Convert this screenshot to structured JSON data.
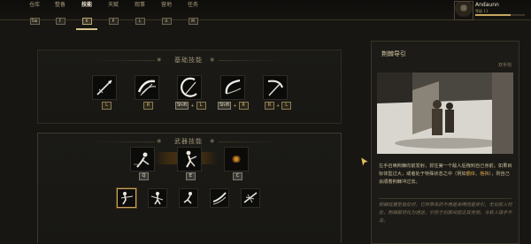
{
  "nav": {
    "tabs": [
      {
        "label": "仓库",
        "key": "Tab"
      },
      {
        "label": "整备",
        "key": "F"
      },
      {
        "label": "技能",
        "key": "K"
      },
      {
        "label": "天赋",
        "key": "P"
      },
      {
        "label": "观事",
        "key": "L"
      },
      {
        "label": "营地",
        "key": "U"
      },
      {
        "label": "任务",
        "key": "M"
      }
    ],
    "active_index": 2
  },
  "player": {
    "name": "Andaunn",
    "subtitle": "等级 11",
    "progress": 0.71
  },
  "basic": {
    "title": "基础技能",
    "skills": [
      {
        "icon": "spear-icon",
        "keys": [
          "L"
        ]
      },
      {
        "icon": "slash-icon",
        "keys": [
          "R"
        ]
      },
      {
        "icon": "crescent-slash-icon",
        "keys": [
          "Shift",
          "L"
        ]
      },
      {
        "icon": "sweep-slash-icon",
        "keys": [
          "Shift",
          "R"
        ]
      },
      {
        "icon": "scythe-icon",
        "keys": [
          "R",
          "L"
        ]
      }
    ]
  },
  "weapon": {
    "title": "武器技能",
    "skills": [
      {
        "icon": "dash-strike-icon",
        "key": "Q"
      },
      {
        "icon": "ninja-leap-icon",
        "key": "E"
      },
      {
        "icon": "locked-skill-icon",
        "key": "C"
      }
    ],
    "row2": [
      {
        "icon": "piercing-stance-icon",
        "selected": true
      },
      {
        "icon": "warrior-stance-icon"
      },
      {
        "icon": "leaping-stance-icon"
      },
      {
        "icon": "wind-slash-icon"
      },
      {
        "icon": "thrust-icon"
      }
    ]
  },
  "info": {
    "title": "荆棘导引",
    "type": "双手剑",
    "desc_part1": "左手召唤荆棘向前发射，抓住第一个敌人后拽到自己身前。如果目标体型过大，或者处于特殊状态之中（例如",
    "desc_hl1": "霸体",
    "desc_sep": "、",
    "desc_hl2": "格挡",
    "desc_part2": "），则自己会顺着荆棘冲过去。",
    "lore": "荆棘延展至极处时，它所带来的不再是束缚而是牵引。无论敌人何处，荆棘都将化为通途，引你于刹那间抵达其身侧，令敌人措手不及。"
  }
}
